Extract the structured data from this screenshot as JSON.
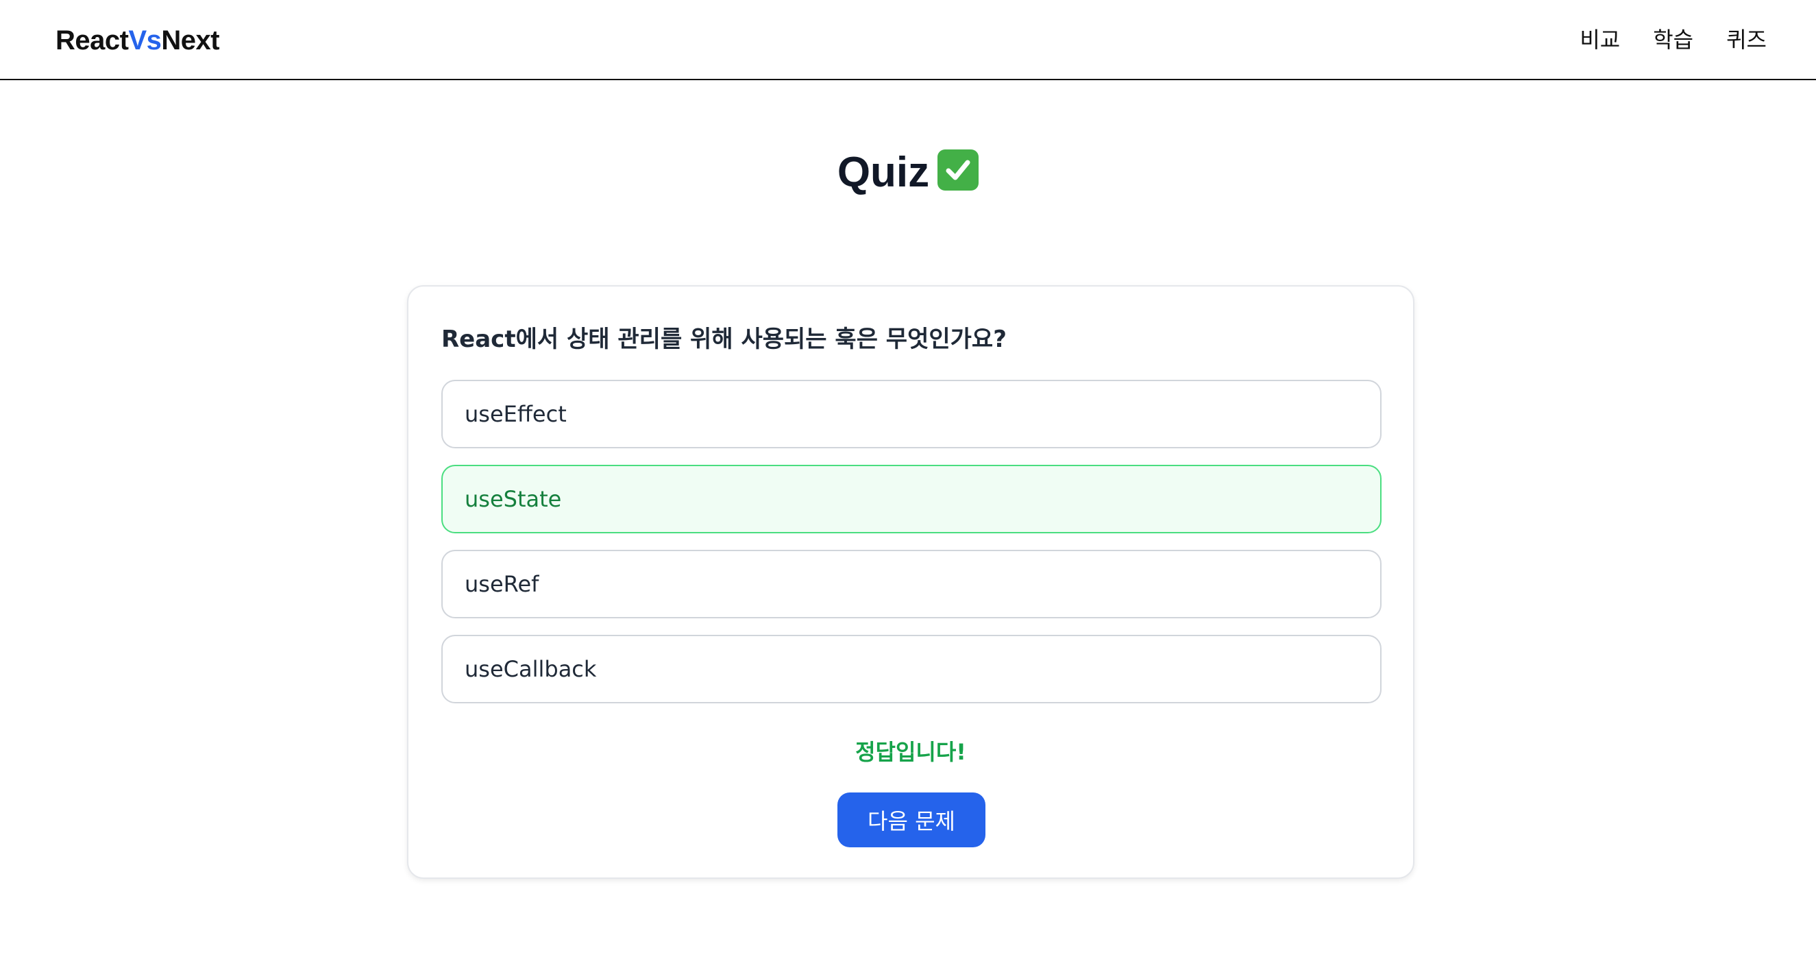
{
  "header": {
    "logo": {
      "part1": "React",
      "part2": "Vs",
      "part3": "Next"
    },
    "nav": [
      {
        "label": "비교"
      },
      {
        "label": "학습"
      },
      {
        "label": "퀴즈"
      }
    ]
  },
  "main": {
    "title": "Quiz",
    "title_icon": "check-mark-button-icon",
    "quiz": {
      "question": "React에서 상태 관리를 위해 사용되는 훅은 무엇인가요?",
      "options": [
        {
          "label": "useEffect",
          "state": "default"
        },
        {
          "label": "useState",
          "state": "correct"
        },
        {
          "label": "useRef",
          "state": "default"
        },
        {
          "label": "useCallback",
          "state": "default"
        }
      ],
      "feedback": "정답입니다!",
      "next_label": "다음 문제"
    }
  },
  "colors": {
    "accent": "#2563eb",
    "correct_border": "#4ade80",
    "correct_bg": "#f0fdf4",
    "correct_text": "#16a34a"
  }
}
